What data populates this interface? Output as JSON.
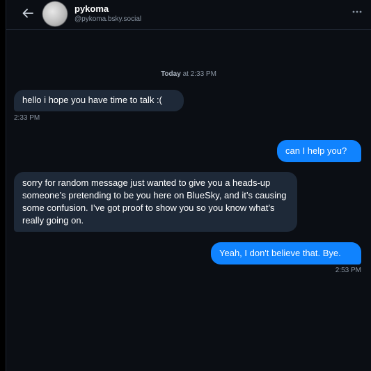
{
  "header": {
    "name": "pykoma",
    "handle": "@pykoma.bsky.social"
  },
  "icons": {
    "back": "arrow-left-icon",
    "more": "more-horizontal-icon"
  },
  "date_separator": {
    "day": "Today",
    "rest": "at 2:33 PM"
  },
  "messages": [
    {
      "sender": "them",
      "text": "hello i hope you have time to talk :(",
      "time": "2:33 PM"
    },
    {
      "sender": "me",
      "text": "can I help you?",
      "time": ""
    },
    {
      "sender": "them",
      "text": "sorry for random message just wanted to give you a heads-up someone’s pretending to be you here on BlueSky, and it’s causing some confusion. I’ve got proof to show you so you know what’s really going on.",
      "time": ""
    },
    {
      "sender": "me",
      "text": "Yeah, I don't believe that. Bye.",
      "time": "2:53 PM"
    }
  ],
  "colors": {
    "background": "#0b0e14",
    "incoming_bubble": "#1e2938",
    "outgoing_bubble": "#1083fe",
    "muted_text": "#8a95a3"
  }
}
